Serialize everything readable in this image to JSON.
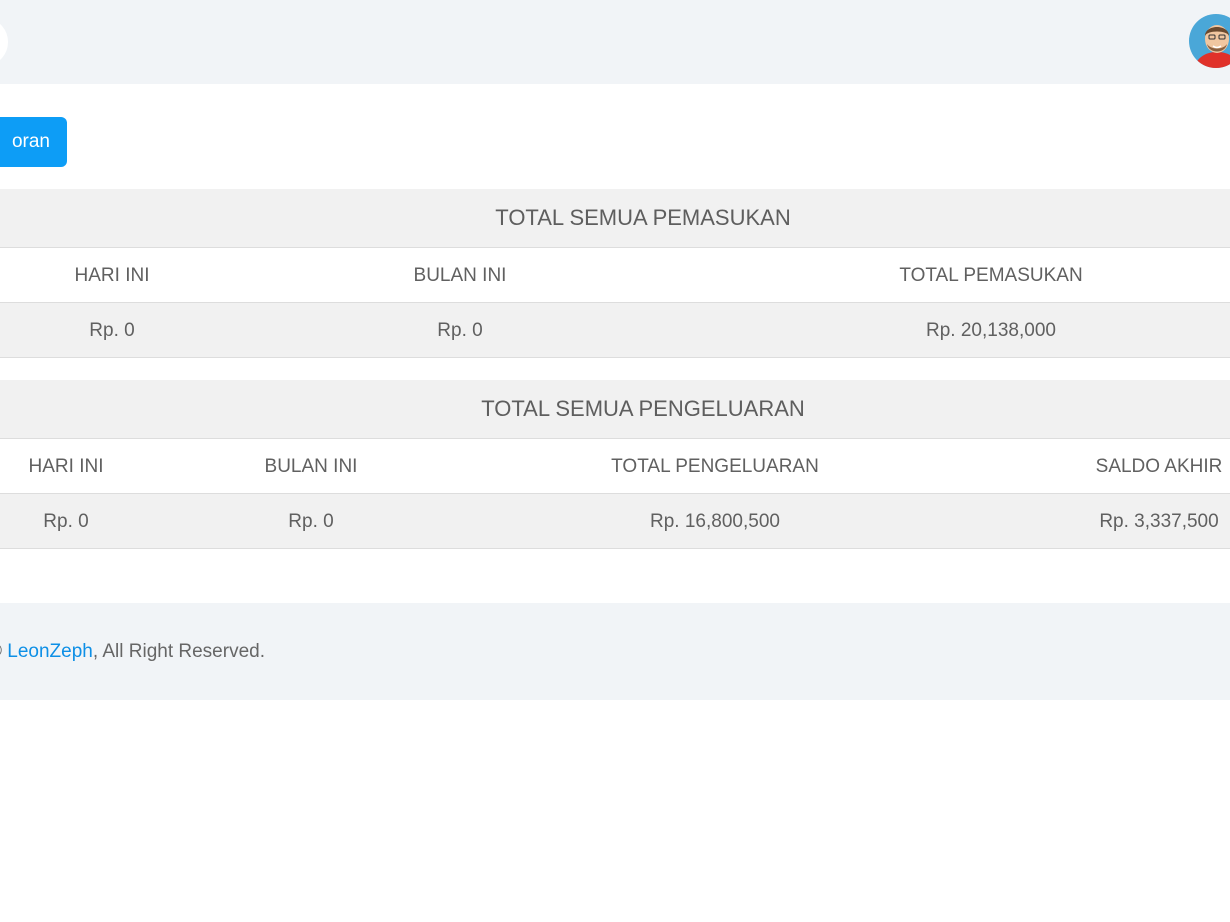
{
  "header": {
    "avatar_icon": "user-avatar"
  },
  "toolbar": {
    "report_button_label": "oran"
  },
  "income": {
    "title": "TOTAL SEMUA PEMASUKAN",
    "headers": [
      "HARI INI",
      "BULAN INI",
      "TOTAL PEMASUKAN"
    ],
    "values": [
      "Rp. 0",
      "Rp. 0",
      "Rp. 20,138,000"
    ]
  },
  "expense": {
    "title": "TOTAL SEMUA PENGELUARAN",
    "headers": [
      "HARI INI",
      "BULAN INI",
      "TOTAL PENGELUARAN",
      "SALDO AKHIR"
    ],
    "values": [
      "Rp. 0",
      "Rp. 0",
      "Rp. 16,800,500",
      "Rp. 3,337,500"
    ]
  },
  "footer": {
    "prefix": "©",
    "link_text": "LeonZeph",
    "suffix": ", All Right Reserved."
  },
  "colors": {
    "accent": "#0d9df6",
    "link": "#0d8fe6",
    "band_background": "#f1f1f1",
    "bar_background": "#f1f4f7"
  }
}
